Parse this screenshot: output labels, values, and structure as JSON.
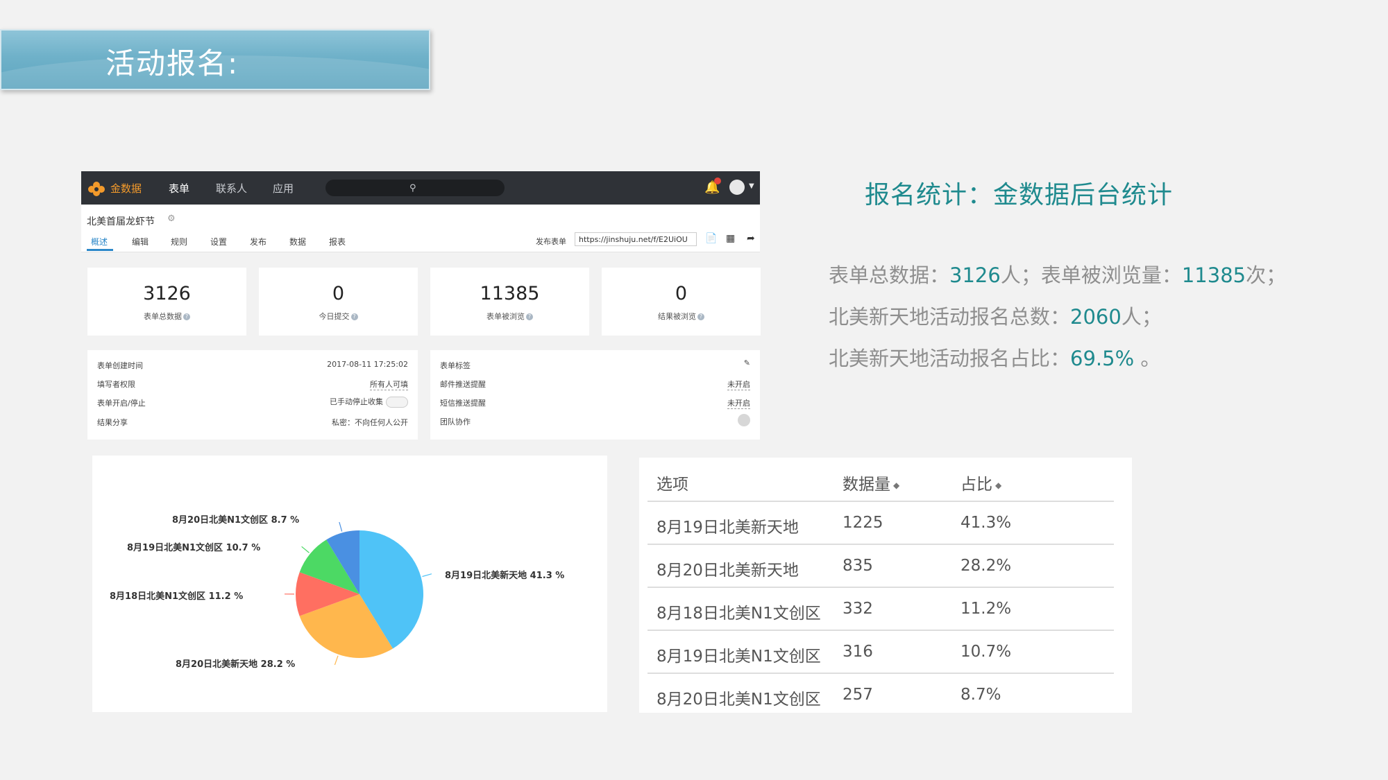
{
  "slide": {
    "title": "活动报名:"
  },
  "dashboard": {
    "brand": "金数据",
    "nav": [
      "表单",
      "联系人",
      "应用"
    ],
    "form_title": "北美首届龙虾节",
    "subtabs": [
      "概述",
      "编辑",
      "规则",
      "设置",
      "发布",
      "数据",
      "报表"
    ],
    "publish_label": "发布表单",
    "publish_url": "https://jinshuju.net/f/E2UiOU",
    "stats": [
      {
        "value": "3126",
        "label": "表单总数据"
      },
      {
        "value": "0",
        "label": "今日提交"
      },
      {
        "value": "11385",
        "label": "表单被浏览"
      },
      {
        "value": "0",
        "label": "结果被浏览"
      }
    ],
    "info_left": [
      {
        "label": "表单创建时间",
        "value": "2017-08-11 17:25:02"
      },
      {
        "label": "填写者权限",
        "value": "所有人可填"
      },
      {
        "label": "表单开启/停止",
        "value": "已手动停止收集"
      },
      {
        "label": "结果分享",
        "value": "私密：不向任何人公开"
      }
    ],
    "info_right": [
      {
        "label": "表单标签",
        "value": ""
      },
      {
        "label": "邮件推送提醒",
        "value": "未开启"
      },
      {
        "label": "短信推送提醒",
        "value": "未开启"
      },
      {
        "label": "团队协作",
        "value": ""
      }
    ]
  },
  "summary": {
    "title": "报名统计：金数据后台统计",
    "line1": {
      "a": "表单总数据：",
      "b": "3126",
      "c": "人；表单被浏览量：",
      "d": "11385",
      "e": "次；"
    },
    "line2": {
      "a": "北美新天地活动报名总数：",
      "b": "2060",
      "c": "人；"
    },
    "line3": {
      "a": "北美新天地活动报名占比：",
      "b": "69.5%",
      "c": " 。"
    }
  },
  "chart_data": {
    "type": "pie",
    "slices": [
      {
        "label": "8月19日北美新天地",
        "value": 41.3,
        "text": "8月19日北美新天地 41.3 %",
        "color": "#4fc3f7"
      },
      {
        "label": "8月20日北美新天地",
        "value": 28.2,
        "text": "8月20日北美新天地 28.2 %",
        "color": "#ffb74d"
      },
      {
        "label": "8月18日北美N1文创区",
        "value": 11.2,
        "text": "8月18日北美N1文创区 11.2 %",
        "color": "#ff6f61"
      },
      {
        "label": "8月19日北美N1文创区",
        "value": 10.7,
        "text": "8月19日北美N1文创区 10.7 %",
        "color": "#4cd964"
      },
      {
        "label": "8月20日北美N1文创区",
        "value": 8.7,
        "text": "8月20日北美N1文创区 8.7 %",
        "color": "#4a90e2"
      }
    ]
  },
  "table": {
    "headers": [
      "选项",
      "数据量",
      "占比"
    ],
    "rows": [
      [
        "8月19日北美新天地",
        "1225",
        "41.3%"
      ],
      [
        "8月20日北美新天地",
        "835",
        "28.2%"
      ],
      [
        "8月18日北美N1文创区",
        "332",
        "11.2%"
      ],
      [
        "8月19日北美N1文创区",
        "316",
        "10.7%"
      ],
      [
        "8月20日北美N1文创区",
        "257",
        "8.7%"
      ]
    ]
  }
}
